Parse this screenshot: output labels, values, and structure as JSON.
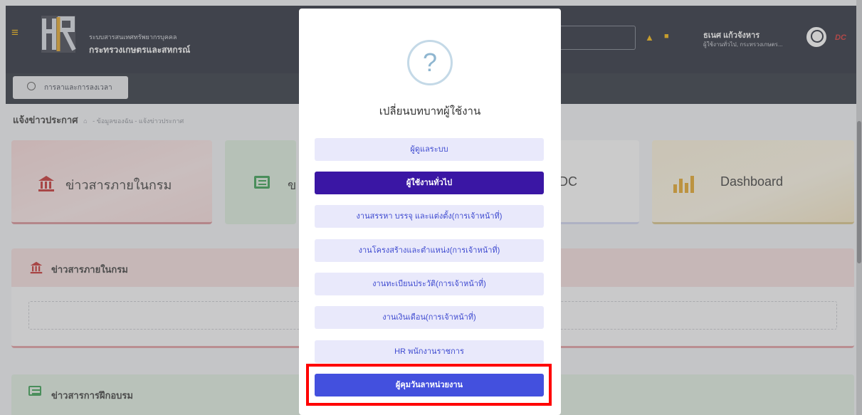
{
  "header": {
    "org_line1": "ระบบสารสนเทศทรัพยากรบุคคล",
    "org_line2": "กระทรวงเกษตรและสหกรณ์",
    "user_name": "ธเนศ แก้วจังหาร",
    "user_role": "ผู้ใช้งานทั่วไป, กระทรวงเกษตร...",
    "dc_tag": "DC"
  },
  "subbar": {
    "leave_button": "การลาและการลงเวลา"
  },
  "breadcrumb": {
    "title": "แจ้งข่าวประกาศ",
    "path": "- ข้อมูลของฉัน - แจ้งข่าวประกาศ"
  },
  "cards": [
    {
      "label": "ข่าวสารภายในกรม"
    },
    {
      "label": "ข"
    },
    {
      "label": "n DC"
    },
    {
      "label": "Dashboard"
    }
  ],
  "panels": [
    {
      "title": "ข่าวสารภายในกรม"
    },
    {
      "title": "ข่าวสารการฝึกอบรม"
    }
  ],
  "modal": {
    "icon": "?",
    "title": "เปลี่ยนบทบาทผู้ใช้งาน",
    "roles": [
      "ผู้ดูแลระบบ",
      "ผู้ใช้งานทั่วไป",
      "งานสรรหา บรรจุ และแต่งตั้ง(การเจ้าหน้าที่)",
      "งานโครงสร้างและตำแหน่ง(การเจ้าหน้าที่)",
      "งานทะเบียนประวัติ(การเจ้าหน้าที่)",
      "งานเงินเดือน(การเจ้าหน้าที่)",
      "HR พนักงานราชการ",
      "ผู้คุมวันลาหน่วยงาน"
    ]
  },
  "colors": {
    "accent": "#3a16a4",
    "highlight": "#ff0000",
    "header_bg": "#1e2331"
  }
}
